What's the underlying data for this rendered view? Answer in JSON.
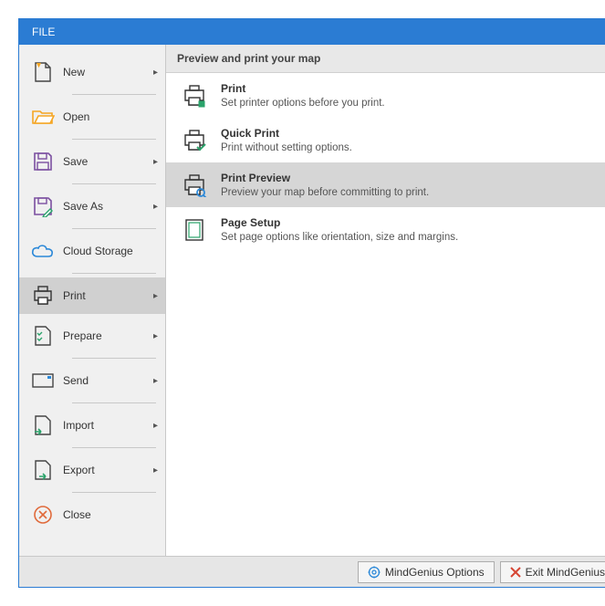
{
  "titlebar": {
    "label": "FILE"
  },
  "sidebar": {
    "items": [
      {
        "key": "new",
        "label": "New",
        "has_submenu": true
      },
      {
        "key": "open",
        "label": "Open",
        "has_submenu": false
      },
      {
        "key": "save",
        "label": "Save",
        "has_submenu": true
      },
      {
        "key": "saveas",
        "label": "Save As",
        "has_submenu": true
      },
      {
        "key": "cloud",
        "label": "Cloud Storage",
        "has_submenu": false
      },
      {
        "key": "print",
        "label": "Print",
        "has_submenu": true,
        "selected": true
      },
      {
        "key": "prepare",
        "label": "Prepare",
        "has_submenu": true
      },
      {
        "key": "send",
        "label": "Send",
        "has_submenu": true
      },
      {
        "key": "import",
        "label": "Import",
        "has_submenu": true
      },
      {
        "key": "export",
        "label": "Export",
        "has_submenu": true
      },
      {
        "key": "close",
        "label": "Close",
        "has_submenu": false
      }
    ]
  },
  "content": {
    "header": "Preview and print your map",
    "options": [
      {
        "key": "print",
        "title": "Print",
        "desc": "Set printer options before you print."
      },
      {
        "key": "quick",
        "title": "Quick Print",
        "desc": "Print without setting options."
      },
      {
        "key": "preview",
        "title": "Print Preview",
        "desc": "Preview your map before committing to print.",
        "highlight": true
      },
      {
        "key": "setup",
        "title": "Page Setup",
        "desc": "Set page options like orientation, size and margins."
      }
    ]
  },
  "footer": {
    "options_label": "MindGenius Options",
    "exit_label": "Exit MindGenius"
  },
  "icons": {
    "new": "new-file-icon",
    "open": "open-folder-icon",
    "save": "save-disk-icon",
    "saveas": "save-as-icon",
    "cloud": "cloud-icon",
    "print": "printer-icon",
    "prepare": "checklist-icon",
    "send": "envelope-icon",
    "import": "import-file-icon",
    "export": "export-file-icon",
    "close": "close-circle-icon",
    "gear": "gear-icon",
    "x": "red-x-icon"
  }
}
